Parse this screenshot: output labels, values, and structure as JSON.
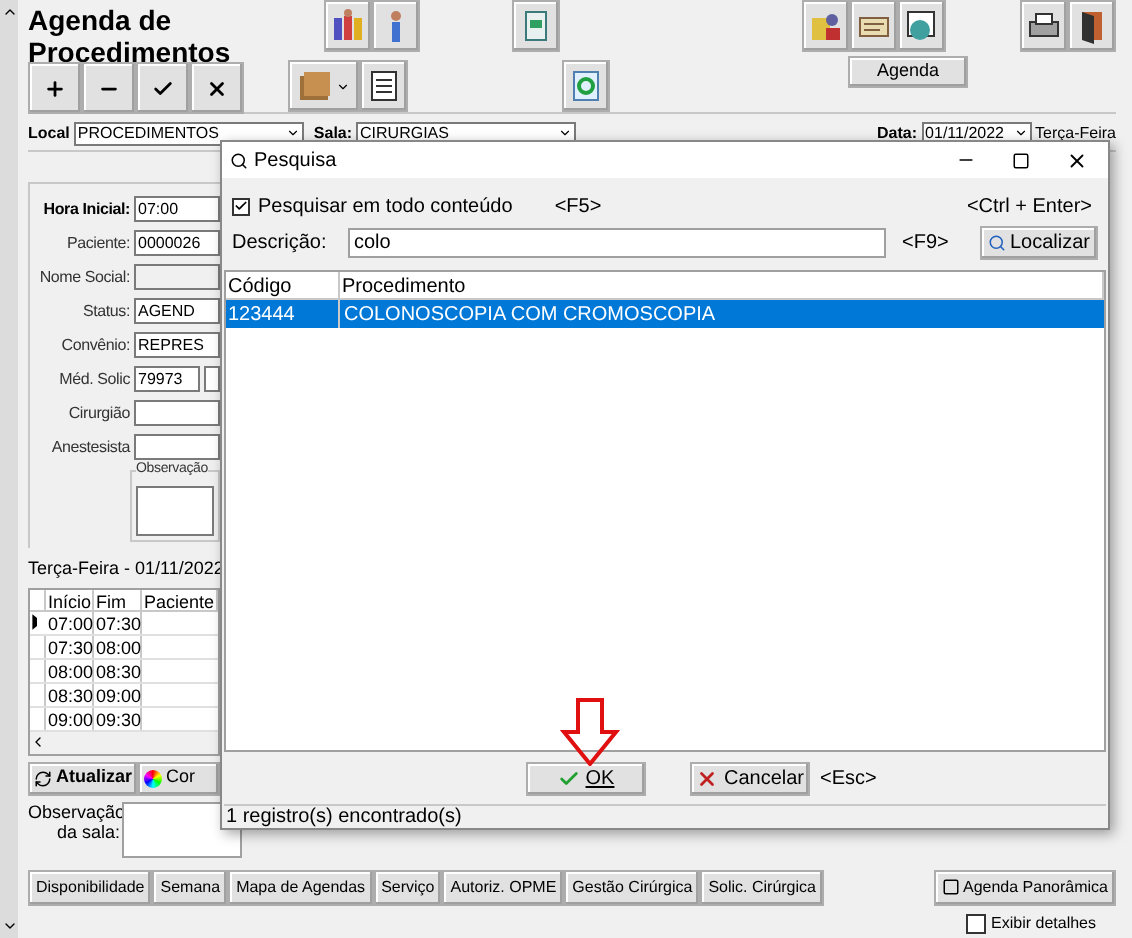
{
  "title": "Agenda de Procedimentos",
  "agenda_button": "Agenda",
  "filters": {
    "local_label": "Local",
    "local_value": "PROCEDIMENTOS",
    "sala_label": "Sala:",
    "sala_value": "CIRURGIAS",
    "data_label": "Data:",
    "data_value": "01/11/2022",
    "weekday": "Terça-Feira"
  },
  "form": {
    "fields": [
      {
        "label": "Hora Inicial:",
        "value": "07:00",
        "kind": "bold"
      },
      {
        "label": "Paciente:",
        "value": "0000026",
        "kind": "normal"
      },
      {
        "label": "Nome Social:",
        "kind": "disabled"
      },
      {
        "label": "Status:",
        "value": "AGEND",
        "kind": "normal"
      },
      {
        "label": "Convênio:",
        "value": "REPRES",
        "kind": "normal"
      },
      {
        "label": "Méd. Solic",
        "value": "79973",
        "kind": "split"
      },
      {
        "label": "Cirurgião",
        "kind": "plain"
      },
      {
        "label": "Anestesista",
        "kind": "plain"
      }
    ],
    "notes_label": "Observação"
  },
  "schedule": {
    "title": "Terça-Feira - 01/11/2022",
    "columns": [
      "Início",
      "Fim",
      "Paciente"
    ],
    "rows": [
      {
        "start": "07:00",
        "end": "07:30",
        "selected": true
      },
      {
        "start": "07:30",
        "end": "08:00",
        "selected": false
      },
      {
        "start": "08:00",
        "end": "08:30",
        "selected": false
      },
      {
        "start": "08:30",
        "end": "09:00",
        "selected": false
      },
      {
        "start": "09:00",
        "end": "09:30",
        "selected": false
      }
    ]
  },
  "refresh_button": "Atualizar",
  "color_button": "Cor",
  "room_note_label": "Observação da sala:",
  "bottom_tabs": [
    "Disponibilidade",
    "Semana",
    "Mapa de Agendas",
    "Serviço",
    "Autoriz. OPME",
    "Gestão Cirúrgica",
    "Solic. Cirúrgica"
  ],
  "panorama_button": "Agenda Panorâmica",
  "show_details": {
    "label": "Exibir detalhes",
    "checked": false
  },
  "dialog": {
    "title": "Pesquisa",
    "search_all": {
      "label": "Pesquisar em todo conteúdo",
      "checked": true
    },
    "search_all_shortcut": "<F5>",
    "confirm_shortcut": "<Ctrl + Enter>",
    "description_label": "Descrição:",
    "description_value": "colo",
    "find_shortcut": "<F9>",
    "find_button": "Localizar",
    "columns": [
      "Código",
      "Procedimento"
    ],
    "rows": [
      {
        "code": "123444",
        "procedure": "COLONOSCOPIA COM CROMOSCOPIA",
        "selected": true
      }
    ],
    "ok_button": "OK",
    "cancel_button": "Cancelar",
    "cancel_shortcut": "<Esc>",
    "status": "1 registro(s) encontrado(s)"
  }
}
